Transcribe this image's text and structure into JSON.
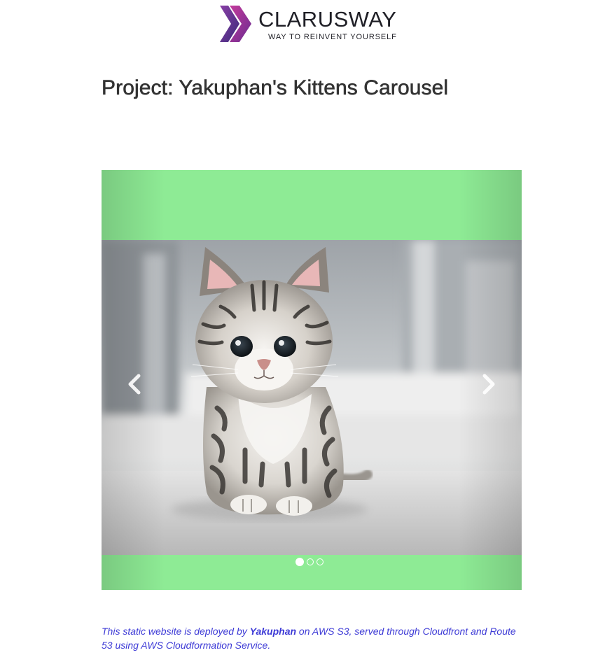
{
  "logo": {
    "wordmark": "CLARUSWAY",
    "tagline": "WAY TO REINVENT YOURSELF"
  },
  "page_title": "Project: Yakuphan's Kittens Carousel",
  "carousel": {
    "active_slide": 1,
    "slide_count": 3,
    "background_color": "#8eeb95",
    "slide_image": "tabby-kitten-photo",
    "prev_icon": "chevron-left-icon",
    "next_icon": "chevron-right-icon"
  },
  "footer": {
    "prefix": "This static website is deployed by ",
    "author": "Yakuphan",
    "suffix": " on AWS S3, served through Cloudfront and Route 53 using AWS Cloudformation Service.",
    "color": "#3d3ad6"
  }
}
